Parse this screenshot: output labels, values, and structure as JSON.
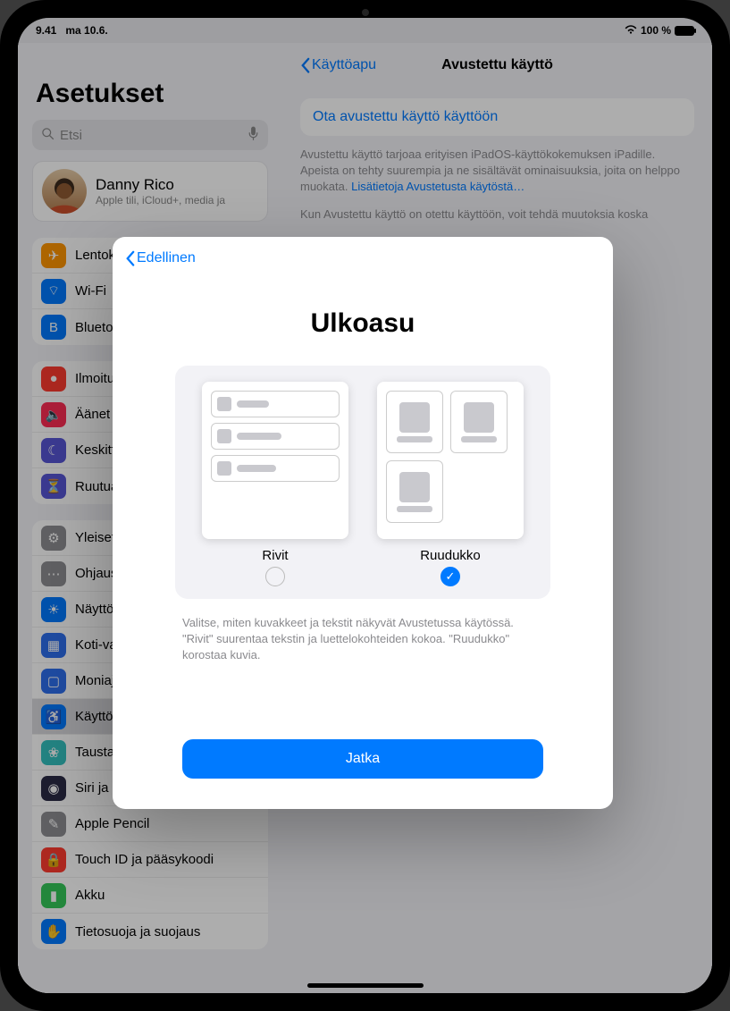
{
  "statusbar": {
    "time": "9.41",
    "date": "ma 10.6.",
    "battery": "100 %"
  },
  "sidebar": {
    "title": "Asetukset",
    "search_placeholder": "Etsi",
    "account": {
      "name": "Danny Rico",
      "sub": "Apple tili, iCloud+, media ja"
    },
    "group1": [
      {
        "label": "Lentokonetila",
        "color": "#ff9500",
        "glyph": "✈"
      },
      {
        "label": "Wi-Fi",
        "color": "#007aff",
        "glyph": "⌔"
      },
      {
        "label": "Bluetooth",
        "color": "#007aff",
        "glyph": "B"
      }
    ],
    "group2": [
      {
        "label": "Ilmoitukset",
        "color": "#ff3b30",
        "glyph": "●"
      },
      {
        "label": "Äänet",
        "color": "#ff2d55",
        "glyph": "🔈"
      },
      {
        "label": "Keskittyminen",
        "color": "#5856d6",
        "glyph": "☾"
      },
      {
        "label": "Ruutuaika",
        "color": "#5856d6",
        "glyph": "⏳"
      }
    ],
    "group3": [
      {
        "label": "Yleiset",
        "color": "#8e8e93",
        "glyph": "⚙"
      },
      {
        "label": "Ohjauskeskus",
        "color": "#8e8e93",
        "glyph": "⋯"
      },
      {
        "label": "Näyttö ja kirkkaus",
        "color": "#007aff",
        "glyph": "☀"
      },
      {
        "label": "Koti-valikko ja moniajo",
        "color": "#2f6fed",
        "glyph": "▦"
      },
      {
        "label": "Moniajo",
        "color": "#2f6fed",
        "glyph": "▢"
      },
      {
        "label": "Käyttöapu",
        "color": "#007aff",
        "glyph": "♿",
        "selected": true
      },
      {
        "label": "Taustakuva",
        "color": "#34c2c0",
        "glyph": "❀"
      },
      {
        "label": "Siri ja haku",
        "color": "#2b2b46",
        "glyph": "◉"
      },
      {
        "label": "Apple Pencil",
        "color": "#8e8e93",
        "glyph": "✎"
      },
      {
        "label": "Touch ID ja pääsykoodi",
        "color": "#ff3b30",
        "glyph": "🔒"
      },
      {
        "label": "Akku",
        "color": "#34c759",
        "glyph": "▮"
      },
      {
        "label": "Tietosuoja ja suojaus",
        "color": "#007aff",
        "glyph": "✋"
      }
    ]
  },
  "detail": {
    "back_label": "Käyttöapu",
    "title": "Avustettu käyttö",
    "enable_link": "Ota avustettu käyttö käyttöön",
    "desc1": "Avustettu käyttö tarjoaa erityisen iPadOS-käyttökokemuksen iPadille. Apeista on tehty suurempia ja ne sisältävät ominaisuuksia, joita on helppo muokata. ",
    "learn_more": "Lisätietoja Avustetusta käytöstä…",
    "desc2": "Kun Avustettu käyttö on otettu käyttöön, voit tehdä muutoksia koska"
  },
  "modal": {
    "back_label": "Edellinen",
    "title": "Ulkoasu",
    "option_rows": "Rivit",
    "option_grid": "Ruudukko",
    "selected": "grid",
    "note": "Valitse, miten kuvakkeet ja tekstit näkyvät Avustetussa käytössä. \"Rivit\" suurentaa tekstin ja luettelokohteiden kokoa. \"Ruudukko\" korostaa kuvia.",
    "continue": "Jatka"
  }
}
